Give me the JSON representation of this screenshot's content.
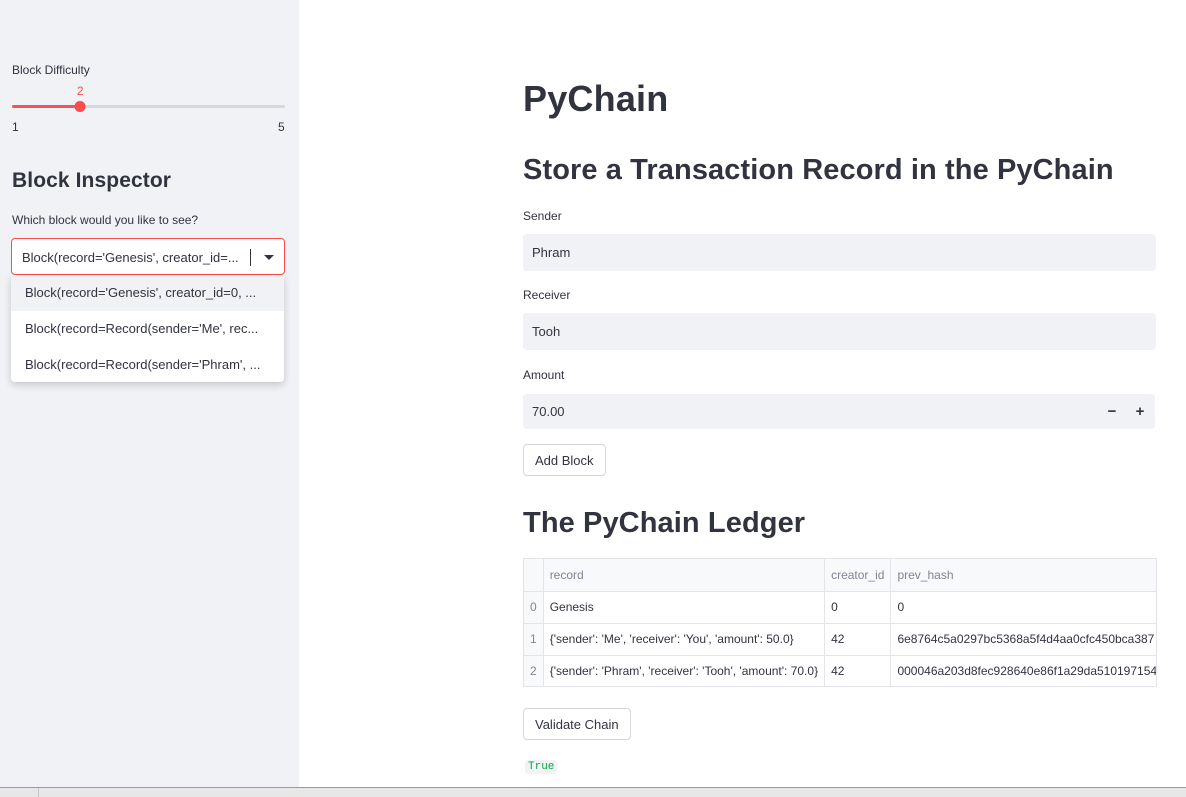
{
  "sidebar": {
    "difficulty": {
      "label": "Block Difficulty",
      "value": 2,
      "value_text": "2",
      "min": 1,
      "max": 5,
      "min_label": "1",
      "max_label": "5"
    },
    "inspector_title": "Block Inspector",
    "select_label": "Which block would you like to see?",
    "selected_value": "Block(record='Genesis', creator_id=...",
    "options": [
      "Block(record='Genesis', creator_id=0, ...",
      "Block(record=Record(sender='Me', rec...",
      "Block(record=Record(sender='Phram', ..."
    ]
  },
  "main": {
    "title": "PyChain",
    "form_title": "Store a Transaction Record in the PyChain",
    "sender": {
      "label": "Sender",
      "value": "Phram"
    },
    "receiver": {
      "label": "Receiver",
      "value": "Tooh"
    },
    "amount": {
      "label": "Amount",
      "value": "70.00",
      "minus": "−",
      "plus": "+"
    },
    "add_block_label": "Add Block",
    "ledger_title": "The PyChain Ledger",
    "table": {
      "columns": [
        "",
        "record",
        "creator_id",
        "prev_hash"
      ],
      "rows": [
        [
          "0",
          "Genesis",
          "0",
          "0"
        ],
        [
          "1",
          "{'sender': 'Me', 'receiver': 'You', 'amount': 50.0}",
          "42",
          "6e8764c5a0297bc5368a5f4d4aa0cfc450bca387"
        ],
        [
          "2",
          "{'sender': 'Phram', 'receiver': 'Tooh', 'amount': 70.0}",
          "42",
          "000046a203d8fec928640e86f1a29da510197154"
        ]
      ]
    },
    "validate_label": "Validate Chain",
    "validation_result": "True"
  },
  "colors": {
    "accent": "#ff4b4b",
    "sidebar_bg": "#f0f2f6",
    "success": "#09ab3b",
    "text": "#31333f"
  }
}
